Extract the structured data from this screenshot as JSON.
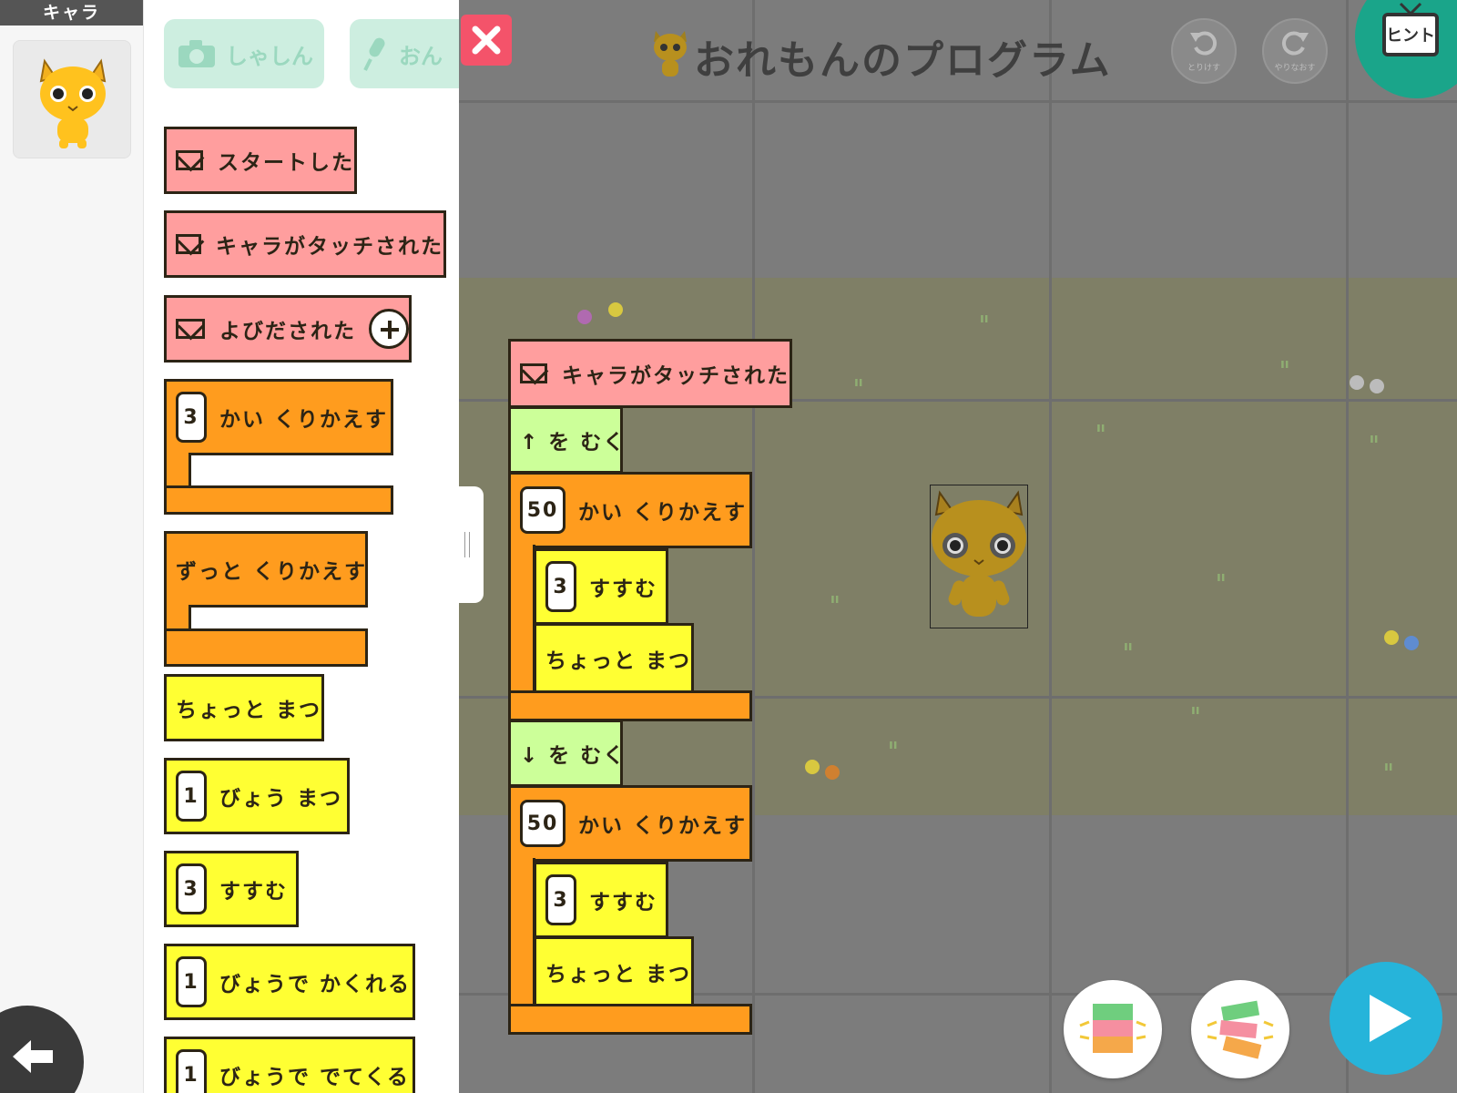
{
  "sidebar": {
    "header": "キャラ"
  },
  "palette": {
    "tools": [
      {
        "label": "しゃしん",
        "icon": "camera-icon"
      },
      {
        "label": "おん",
        "icon": "microphone-icon"
      }
    ],
    "blocks": {
      "start": "スタートした",
      "touched": "キャラがタッチされた",
      "called": "よびだされた",
      "repeat_n": {
        "count": "3",
        "label": "かい くりかえす"
      },
      "forever": "ずっと くりかえす",
      "wait": "ちょっと まつ",
      "wait_sec": {
        "count": "1",
        "label": "びょう まつ"
      },
      "move": {
        "count": "3",
        "label": "すすむ"
      },
      "hide": {
        "count": "1",
        "label": "びょうで かくれる"
      },
      "show": {
        "count": "1",
        "label": "びょうで でてくる"
      }
    }
  },
  "stage": {
    "title": "おれもんのプログラム",
    "undo_label": "とりけす",
    "redo_label": "やりなおす",
    "hint_label": "ヒント"
  },
  "program": {
    "trigger": "キャラがタッチされた",
    "face_up": "↑ を むく",
    "loop1": {
      "count": "50",
      "label": "かい くりかえす"
    },
    "loop1_move": {
      "count": "3",
      "label": "すすむ"
    },
    "loop1_wait": "ちょっと まつ",
    "face_down": "↓ を むく",
    "loop2": {
      "count": "50",
      "label": "かい くりかえす"
    },
    "loop2_move": {
      "count": "3",
      "label": "すすむ"
    },
    "loop2_wait": "ちょっと まつ"
  },
  "colors": {
    "event": "#ff9e9e",
    "loop": "#ff9c1e",
    "action": "#ffff33",
    "direction": "#ccff99",
    "close": "#f4536a",
    "hint": "#1aa58a",
    "play": "#26b4da"
  }
}
